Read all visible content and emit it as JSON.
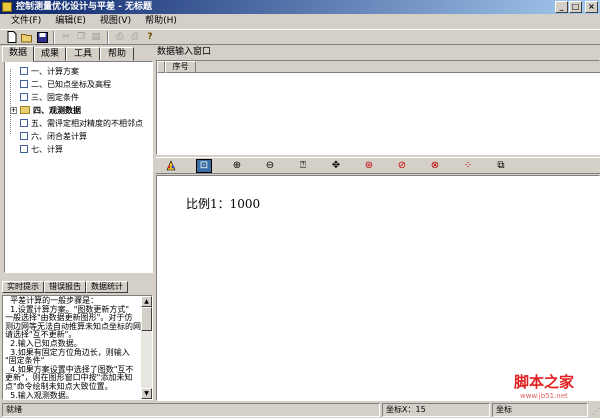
{
  "window": {
    "title": "控制测量优化设计与平差 - 无标题",
    "controls": [
      "_",
      "□",
      "×"
    ]
  },
  "menu": [
    "文件(F)",
    "编辑(E)",
    "视图(V)",
    "帮助(H)"
  ],
  "toolbar_icons": [
    "new-file-icon",
    "open-folder-icon",
    "save-icon",
    "cut-icon",
    "copy-icon",
    "paste-icon",
    "print-preview-icon",
    "print-icon",
    "help-icon"
  ],
  "left_tabs": [
    "数据",
    "成果",
    "工具",
    "帮助"
  ],
  "tree": [
    "一、计算方案",
    "二、已知点坐标及高程",
    "三、固定条件",
    "四、观测数据",
    "五、需评定相对精度的不相邻点",
    "六、闭合差计算",
    "七、计算"
  ],
  "bottom_tabs": [
    "实时提示",
    "错误报告",
    "数据统计"
  ],
  "hint_text": "  平差计算的一般步骤是：\n  1.设置计算方案。\"图数更新方式\"\n一般选择\"由数据更新图形\"。对于仿\n测边网等无法自动推算未知点坐标的网\n请选择\"互不更新\"。\n  2.输入已知点数据。\n  3.如果有固定方位角边长，则输入\n\"固定条件\"\n  4.如果方案设置中选择了图数\"互不\n更新\"，则在图形窗口中按\"添加未知\n点\"命令绘制未知点大致位置。\n  5.输入观测数据。",
  "data_panel": {
    "title": "数据输入窗口",
    "column": "序号"
  },
  "canvas": {
    "scale_label": "比例1：1000"
  },
  "watermark": {
    "main": "脚本之家",
    "sub": "www.jb51.net"
  },
  "status": {
    "text": "就绪",
    "coord_x": "坐标X：15",
    "coord_y": "坐标"
  }
}
